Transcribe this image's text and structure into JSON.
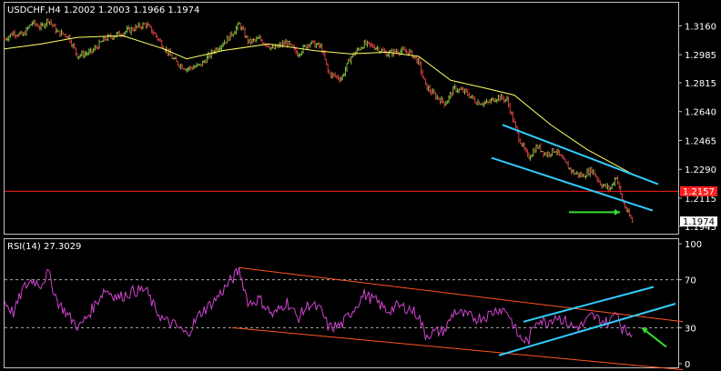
{
  "colors": {
    "background": "#000000",
    "frame": "#c0c0c0",
    "bull_bar": "#7fbf3f",
    "bear_bar": "#d04040",
    "moving_average": "#ffff66",
    "channel": "#33ccff",
    "arrow": "#33dd33",
    "horizontal_line": "#ff2020",
    "rsi_line": "#cc44cc",
    "rsi_trendline": "#ff5522",
    "level_line": "#aaaaaa"
  },
  "chart_data": [
    {
      "type": "line",
      "subtype": "ohlc-bars",
      "title": "USDCHF,H4  1.2002 1.2003 1.1966 1.1974",
      "symbol": "USDCHF",
      "timeframe": "H4",
      "last_bar": {
        "open": 1.2002,
        "high": 1.2003,
        "low": 1.1966,
        "close": 1.1974
      },
      "price_label": "1.1974",
      "ylim": [
        1.19,
        1.33
      ],
      "y_ticks": [
        "1.3160",
        "1.2985",
        "1.2815",
        "1.2640",
        "1.2465",
        "1.2290",
        "1.2115",
        "1.1945"
      ],
      "horizontal_line": {
        "value": 1.2157,
        "label": "1.2157"
      },
      "moving_average": [
        [
          0,
          1.302
        ],
        [
          40,
          1.305
        ],
        [
          80,
          1.309
        ],
        [
          130,
          1.31
        ],
        [
          175,
          1.302
        ],
        [
          200,
          1.296
        ],
        [
          240,
          1.301
        ],
        [
          290,
          1.305
        ],
        [
          340,
          1.301
        ],
        [
          380,
          1.299
        ],
        [
          420,
          1.3
        ],
        [
          455,
          1.2975
        ],
        [
          490,
          1.283
        ],
        [
          530,
          1.278
        ],
        [
          560,
          1.274
        ],
        [
          600,
          1.256
        ],
        [
          640,
          1.241
        ],
        [
          670,
          1.232
        ],
        [
          690,
          1.226
        ]
      ],
      "price_path": [
        [
          0,
          1.308
        ],
        [
          10,
          1.312
        ],
        [
          20,
          1.31
        ],
        [
          30,
          1.318
        ],
        [
          40,
          1.315
        ],
        [
          48,
          1.32
        ],
        [
          58,
          1.312
        ],
        [
          70,
          1.31
        ],
        [
          80,
          1.298
        ],
        [
          95,
          1.3
        ],
        [
          110,
          1.308
        ],
        [
          125,
          1.311
        ],
        [
          140,
          1.314
        ],
        [
          155,
          1.317
        ],
        [
          165,
          1.311
        ],
        [
          175,
          1.303
        ],
        [
          188,
          1.294
        ],
        [
          200,
          1.29
        ],
        [
          215,
          1.292
        ],
        [
          230,
          1.301
        ],
        [
          245,
          1.308
        ],
        [
          258,
          1.317
        ],
        [
          268,
          1.306
        ],
        [
          280,
          1.308
        ],
        [
          295,
          1.302
        ],
        [
          310,
          1.306
        ],
        [
          322,
          1.299
        ],
        [
          335,
          1.306
        ],
        [
          348,
          1.303
        ],
        [
          356,
          1.287
        ],
        [
          370,
          1.284
        ],
        [
          380,
          1.297
        ],
        [
          395,
          1.305
        ],
        [
          408,
          1.303
        ],
        [
          420,
          1.299
        ],
        [
          432,
          1.301
        ],
        [
          445,
          1.3
        ],
        [
          455,
          1.294
        ],
        [
          462,
          1.28
        ],
        [
          472,
          1.274
        ],
        [
          484,
          1.269
        ],
        [
          494,
          1.278
        ],
        [
          506,
          1.276
        ],
        [
          518,
          1.27
        ],
        [
          530,
          1.269
        ],
        [
          542,
          1.273
        ],
        [
          552,
          1.271
        ],
        [
          558,
          1.26
        ],
        [
          565,
          1.248
        ],
        [
          575,
          1.236
        ],
        [
          585,
          1.243
        ],
        [
          595,
          1.238
        ],
        [
          605,
          1.241
        ],
        [
          615,
          1.233
        ],
        [
          625,
          1.227
        ],
        [
          635,
          1.225
        ],
        [
          645,
          1.229
        ],
        [
          655,
          1.22
        ],
        [
          665,
          1.217
        ],
        [
          672,
          1.225
        ],
        [
          678,
          1.211
        ],
        [
          684,
          1.203
        ],
        [
          690,
          1.197
        ]
      ],
      "channel_lines": [
        {
          "from": [
            547,
            1.256
          ],
          "to": [
            718,
            1.22
          ]
        },
        {
          "from": [
            535,
            1.236
          ],
          "to": [
            712,
            1.204
          ]
        }
      ],
      "arrow": {
        "from": [
          620,
          1.203
        ],
        "to": [
          676,
          1.203
        ],
        "color": "green"
      }
    },
    {
      "type": "line",
      "title": "RSI(14) 27.3029",
      "indicator": "RSI(14)",
      "value": "27.3029",
      "ylim": [
        0,
        100
      ],
      "y_ticks": [
        "100",
        "70",
        "30",
        "0"
      ],
      "levels": [
        70,
        30
      ],
      "rsi_path": [
        [
          0,
          52
        ],
        [
          10,
          42
        ],
        [
          20,
          62
        ],
        [
          30,
          70
        ],
        [
          40,
          66
        ],
        [
          48,
          76
        ],
        [
          58,
          52
        ],
        [
          70,
          40
        ],
        [
          82,
          30
        ],
        [
          95,
          44
        ],
        [
          110,
          62
        ],
        [
          125,
          55
        ],
        [
          140,
          60
        ],
        [
          155,
          62
        ],
        [
          165,
          46
        ],
        [
          175,
          36
        ],
        [
          188,
          32
        ],
        [
          200,
          24
        ],
        [
          215,
          42
        ],
        [
          230,
          52
        ],
        [
          245,
          66
        ],
        [
          258,
          78
        ],
        [
          268,
          50
        ],
        [
          280,
          54
        ],
        [
          295,
          40
        ],
        [
          310,
          52
        ],
        [
          322,
          38
        ],
        [
          335,
          50
        ],
        [
          348,
          44
        ],
        [
          356,
          30
        ],
        [
          370,
          32
        ],
        [
          380,
          42
        ],
        [
          395,
          58
        ],
        [
          408,
          52
        ],
        [
          420,
          44
        ],
        [
          432,
          48
        ],
        [
          445,
          46
        ],
        [
          455,
          40
        ],
        [
          462,
          24
        ],
        [
          472,
          26
        ],
        [
          484,
          28
        ],
        [
          494,
          44
        ],
        [
          506,
          40
        ],
        [
          518,
          38
        ],
        [
          530,
          40
        ],
        [
          542,
          46
        ],
        [
          552,
          44
        ],
        [
          558,
          34
        ],
        [
          565,
          22
        ],
        [
          575,
          18
        ],
        [
          585,
          38
        ],
        [
          595,
          34
        ],
        [
          605,
          40
        ],
        [
          615,
          36
        ],
        [
          625,
          30
        ],
        [
          635,
          32
        ],
        [
          645,
          40
        ],
        [
          655,
          36
        ],
        [
          665,
          34
        ],
        [
          672,
          46
        ],
        [
          678,
          30
        ],
        [
          684,
          26
        ],
        [
          690,
          27
        ]
      ],
      "trend_lines": [
        {
          "from": [
            258,
            80
          ],
          "to": [
            745,
            35
          ],
          "color": "orange"
        },
        {
          "from": [
            250,
            30
          ],
          "to": [
            745,
            -5
          ],
          "color": "orange"
        },
        {
          "from": [
            570,
            35
          ],
          "to": [
            713,
            64
          ],
          "color": "cyan"
        },
        {
          "from": [
            543,
            7
          ],
          "to": [
            737,
            50
          ],
          "color": "cyan"
        }
      ],
      "arrow": {
        "from": [
          727,
          14
        ],
        "to": [
          700,
          30
        ],
        "color": "green"
      }
    }
  ]
}
